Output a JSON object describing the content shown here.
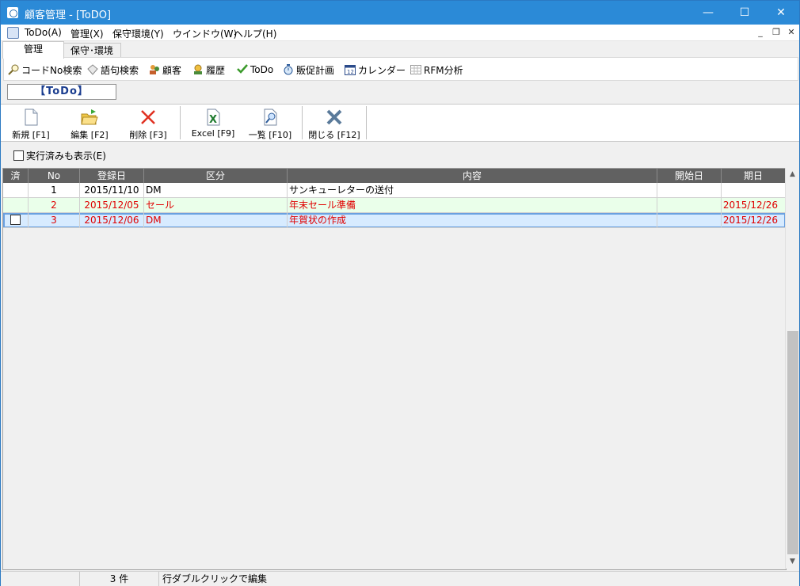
{
  "window": {
    "title": "顧客管理 - [ToDO]"
  },
  "menu": [
    "ToDo(A)",
    "管理(X)",
    "保守環境(Y)",
    "ウインドウ(W)",
    "ヘルプ(H)"
  ],
  "tabs": [
    "管理",
    "保守･環境"
  ],
  "nav": [
    "コードNo検索",
    "語句検索",
    "顧客",
    "履歴",
    "ToDo",
    "販促計画",
    "カレンダー",
    "RFM分析"
  ],
  "section_label": "【ToDo】",
  "toolbar": [
    "新規 [F1]",
    "編集 [F2]",
    "削除 [F3]",
    "Excel [F9]",
    "一覧 [F10]",
    "閉じる [F12]"
  ],
  "show_done_label": "実行済みも表示(E)",
  "grid": {
    "headers": [
      "済",
      "No",
      "登録日",
      "区分",
      "内容",
      "開始日",
      "期日"
    ],
    "rows": [
      [
        "",
        "1",
        "2015/11/10",
        "DM",
        "サンキューレターの送付",
        "",
        ""
      ],
      [
        "",
        "2",
        "2015/12/05",
        "セール",
        "年末セール準備",
        "",
        "2015/12/26"
      ],
      [
        "",
        "3",
        "2015/12/06",
        "DM",
        "年賀状の作成",
        "",
        "2015/12/26"
      ]
    ]
  },
  "status": {
    "count": "3 件",
    "hint": "行ダブルクリックで編集"
  },
  "colors": {
    "titlebar": "#2b8ad7",
    "overdue_text": "#e00000",
    "selected_row": "#d7ebff",
    "alt_row": "#eaffea"
  }
}
